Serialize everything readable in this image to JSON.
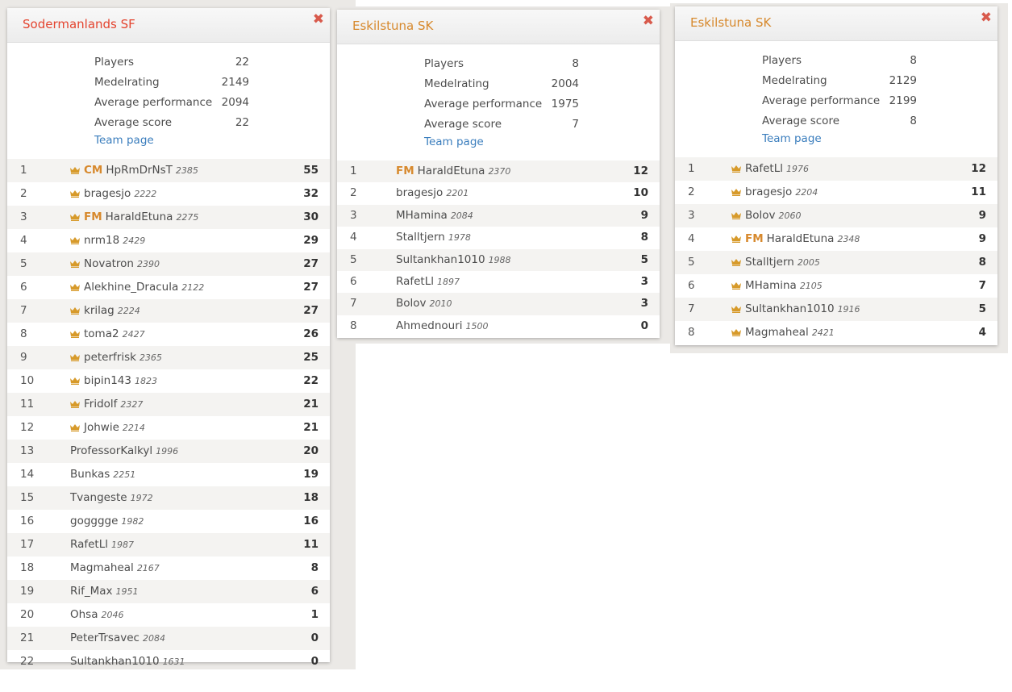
{
  "colors": {
    "crown": "#d79a2a",
    "title_red": "#e4442f",
    "title_orange": "#d7892d",
    "link": "#3a7dbd",
    "close": "#d85a4c"
  },
  "labels": {
    "players": "Players",
    "medelrating": "Medelrating",
    "avg_perf": "Average performance",
    "avg_score": "Average score",
    "team_page": "Team page",
    "close": "✖"
  },
  "cards": [
    {
      "name": "Sodermanlands SF",
      "stats": {
        "players": "22",
        "medelrating": "2149",
        "avg_perf": "2094",
        "avg_score": "22"
      },
      "rows": [
        {
          "rank": "1",
          "crown": true,
          "title": "CM",
          "name": "HpRmDrNsT",
          "rating": "2385",
          "score": "55"
        },
        {
          "rank": "2",
          "crown": true,
          "title": "",
          "name": "bragesjo",
          "rating": "2222",
          "score": "32"
        },
        {
          "rank": "3",
          "crown": true,
          "title": "FM",
          "name": "HaraldEtuna",
          "rating": "2275",
          "score": "30"
        },
        {
          "rank": "4",
          "crown": true,
          "title": "",
          "name": "nrm18",
          "rating": "2429",
          "score": "29"
        },
        {
          "rank": "5",
          "crown": true,
          "title": "",
          "name": "Novatron",
          "rating": "2390",
          "score": "27"
        },
        {
          "rank": "6",
          "crown": true,
          "title": "",
          "name": "Alekhine_Dracula",
          "rating": "2122",
          "score": "27"
        },
        {
          "rank": "7",
          "crown": true,
          "title": "",
          "name": "krilag",
          "rating": "2224",
          "score": "27"
        },
        {
          "rank": "8",
          "crown": true,
          "title": "",
          "name": "toma2",
          "rating": "2427",
          "score": "26"
        },
        {
          "rank": "9",
          "crown": true,
          "title": "",
          "name": "peterfrisk",
          "rating": "2365",
          "score": "25"
        },
        {
          "rank": "10",
          "crown": true,
          "title": "",
          "name": "bipin143",
          "rating": "1823",
          "score": "22"
        },
        {
          "rank": "11",
          "crown": true,
          "title": "",
          "name": "Fridolf",
          "rating": "2327",
          "score": "21"
        },
        {
          "rank": "12",
          "crown": true,
          "title": "",
          "name": "Johwie",
          "rating": "2214",
          "score": "21"
        },
        {
          "rank": "13",
          "crown": false,
          "title": "",
          "name": "ProfessorKalkyl",
          "rating": "1996",
          "score": "20"
        },
        {
          "rank": "14",
          "crown": false,
          "title": "",
          "name": "Bunkas",
          "rating": "2251",
          "score": "19"
        },
        {
          "rank": "15",
          "crown": false,
          "title": "",
          "name": "Tvangeste",
          "rating": "1972",
          "score": "18"
        },
        {
          "rank": "16",
          "crown": false,
          "title": "",
          "name": "gogggge",
          "rating": "1982",
          "score": "16"
        },
        {
          "rank": "17",
          "crown": false,
          "title": "",
          "name": "RafetLl",
          "rating": "1987",
          "score": "11"
        },
        {
          "rank": "18",
          "crown": false,
          "title": "",
          "name": "Magmaheal",
          "rating": "2167",
          "score": "8"
        },
        {
          "rank": "19",
          "crown": false,
          "title": "",
          "name": "Rif_Max",
          "rating": "1951",
          "score": "6"
        },
        {
          "rank": "20",
          "crown": false,
          "title": "",
          "name": "Ohsa",
          "rating": "2046",
          "score": "1"
        },
        {
          "rank": "21",
          "crown": false,
          "title": "",
          "name": "PeterTrsavec",
          "rating": "2084",
          "score": "0"
        },
        {
          "rank": "22",
          "crown": false,
          "title": "",
          "name": "Sultankhan1010",
          "rating": "1631",
          "score": "0"
        }
      ]
    },
    {
      "name": "Eskilstuna SK",
      "stats": {
        "players": "8",
        "medelrating": "2004",
        "avg_perf": "1975",
        "avg_score": "7"
      },
      "rows": [
        {
          "rank": "1",
          "crown": false,
          "title": "FM",
          "name": "HaraldEtuna",
          "rating": "2370",
          "score": "12"
        },
        {
          "rank": "2",
          "crown": false,
          "title": "",
          "name": "bragesjo",
          "rating": "2201",
          "score": "10"
        },
        {
          "rank": "3",
          "crown": false,
          "title": "",
          "name": "MHamina",
          "rating": "2084",
          "score": "9"
        },
        {
          "rank": "4",
          "crown": false,
          "title": "",
          "name": "Stalltjern",
          "rating": "1978",
          "score": "8"
        },
        {
          "rank": "5",
          "crown": false,
          "title": "",
          "name": "Sultankhan1010",
          "rating": "1988",
          "score": "5"
        },
        {
          "rank": "6",
          "crown": false,
          "title": "",
          "name": "RafetLl",
          "rating": "1897",
          "score": "3"
        },
        {
          "rank": "7",
          "crown": false,
          "title": "",
          "name": "Bolov",
          "rating": "2010",
          "score": "3"
        },
        {
          "rank": "8",
          "crown": false,
          "title": "",
          "name": "Ahmednouri",
          "rating": "1500",
          "score": "0"
        }
      ]
    },
    {
      "name": "Eskilstuna SK",
      "stats": {
        "players": "8",
        "medelrating": "2129",
        "avg_perf": "2199",
        "avg_score": "8"
      },
      "rows": [
        {
          "rank": "1",
          "crown": true,
          "title": "",
          "name": "RafetLl",
          "rating": "1976",
          "score": "12"
        },
        {
          "rank": "2",
          "crown": true,
          "title": "",
          "name": "bragesjo",
          "rating": "2204",
          "score": "11"
        },
        {
          "rank": "3",
          "crown": true,
          "title": "",
          "name": "Bolov",
          "rating": "2060",
          "score": "9"
        },
        {
          "rank": "4",
          "crown": true,
          "title": "FM",
          "name": "HaraldEtuna",
          "rating": "2348",
          "score": "9"
        },
        {
          "rank": "5",
          "crown": true,
          "title": "",
          "name": "Stalltjern",
          "rating": "2005",
          "score": "8"
        },
        {
          "rank": "6",
          "crown": true,
          "title": "",
          "name": "MHamina",
          "rating": "2105",
          "score": "7"
        },
        {
          "rank": "7",
          "crown": true,
          "title": "",
          "name": "Sultankhan1010",
          "rating": "1916",
          "score": "5"
        },
        {
          "rank": "8",
          "crown": true,
          "title": "",
          "name": "Magmaheal",
          "rating": "2421",
          "score": "4"
        }
      ]
    }
  ]
}
